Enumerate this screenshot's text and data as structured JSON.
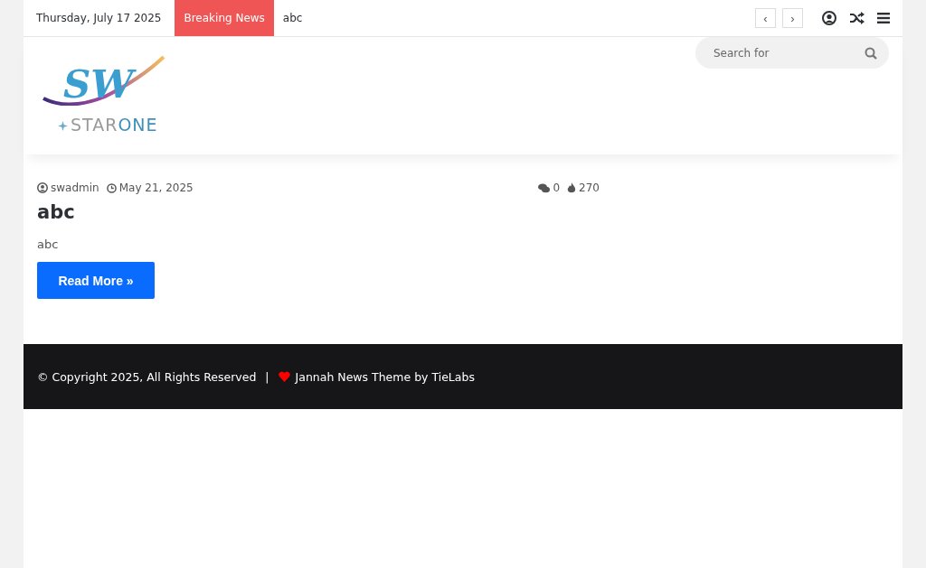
{
  "top_bar": {
    "date": "Thursday, July 17 2025",
    "breaking_label": "Breaking News",
    "breaking_headline": "abc",
    "prev": "‹",
    "next": "›"
  },
  "logo": {
    "mark": "SW",
    "name_first": "STAR",
    "name_second": "ONE"
  },
  "search": {
    "placeholder": "Search for"
  },
  "post": {
    "author": "swadmin",
    "date": "May 21, 2025",
    "comments": "0",
    "views": "270",
    "title": "abc",
    "excerpt": "abc",
    "read_more": "Read More »"
  },
  "footer": {
    "copyright": "© Copyright 2025, All Rights Reserved",
    "separator": "|",
    "credit": "Jannah News Theme by TieLabs"
  }
}
